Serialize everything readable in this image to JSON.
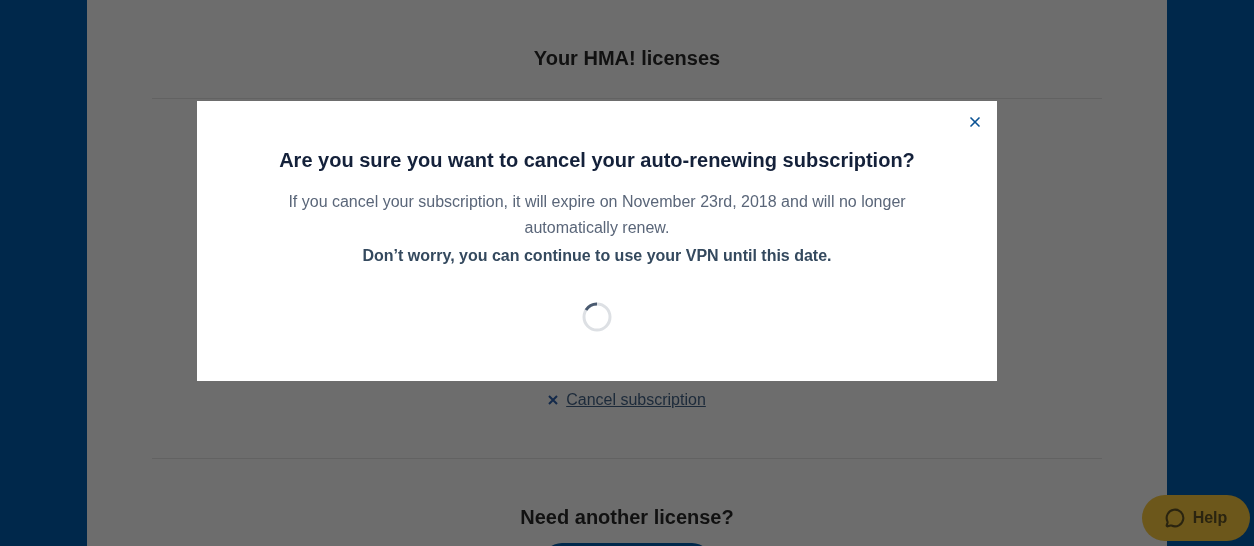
{
  "page": {
    "title": "Your HMA! licenses",
    "cancel_link": "Cancel subscription",
    "section_heading": "Need another license?"
  },
  "modal": {
    "title": "Are you sure you want to cancel your auto-renewing subscription?",
    "body": "If you cancel your subscription, it will expire on November 23rd, 2018 and will no longer automatically renew.",
    "note": "Don’t worry, you can continue to use your VPN until this date."
  },
  "help_button": {
    "label": "Help"
  }
}
